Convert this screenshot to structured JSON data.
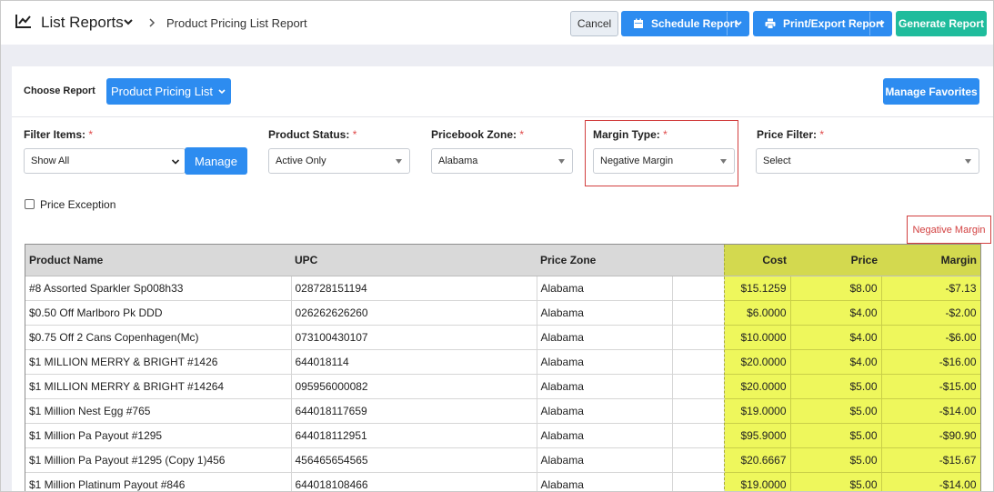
{
  "header": {
    "app_title": "List Reports",
    "breadcrumb": "Product Pricing List Report",
    "cancel_label": "Cancel",
    "schedule_label": "Schedule Report",
    "print_label": "Print/Export Report",
    "generate_label": "Generate Report"
  },
  "report_bar": {
    "choose_label": "Choose Report",
    "report_button_label": "Product Pricing List",
    "manage_favorites_label": "Manage Favorites"
  },
  "filters": {
    "filter_items": {
      "label": "Filter Items:",
      "value": "Show All",
      "manage_label": "Manage"
    },
    "product_status": {
      "label": "Product Status:",
      "value": "Active Only"
    },
    "pricebook_zone": {
      "label": "Pricebook Zone:",
      "value": "Alabama"
    },
    "margin_type": {
      "label": "Margin Type:",
      "value": "Negative Margin"
    },
    "price_filter": {
      "label": "Price Filter:",
      "value": "Select"
    },
    "required_mark": "*",
    "price_exception_label": "Price Exception"
  },
  "annotation": {
    "tag": "Negative Margin"
  },
  "table": {
    "columns": [
      "Product Name",
      "UPC",
      "Price Zone",
      "",
      "Cost",
      "Price",
      "Margin"
    ],
    "rows": [
      [
        "#8 Assorted Sparkler Sp008h33",
        "028728151194",
        "Alabama",
        "",
        "$15.1259",
        "$8.00",
        "-$7.13"
      ],
      [
        "$0.50 Off Marlboro Pk DDD",
        "026262626260",
        "Alabama",
        "",
        "$6.0000",
        "$4.00",
        "-$2.00"
      ],
      [
        "$0.75 Off 2 Cans Copenhagen(Mc)",
        "073100430107",
        "Alabama",
        "",
        "$10.0000",
        "$4.00",
        "-$6.00"
      ],
      [
        "$1 MILLION MERRY & BRIGHT #1426",
        "644018114",
        "Alabama",
        "",
        "$20.0000",
        "$4.00",
        "-$16.00"
      ],
      [
        "$1 MILLION MERRY & BRIGHT #14264",
        "095956000082",
        "Alabama",
        "",
        "$20.0000",
        "$5.00",
        "-$15.00"
      ],
      [
        "$1 Million Nest Egg #765",
        "644018117659",
        "Alabama",
        "",
        "$19.0000",
        "$5.00",
        "-$14.00"
      ],
      [
        "$1 Million Pa Payout #1295",
        "644018112951",
        "Alabama",
        "",
        "$95.9000",
        "$5.00",
        "-$90.90"
      ],
      [
        "$1 Million Pa Payout #1295 (Copy 1)456",
        "456465654565",
        "Alabama",
        "",
        "$20.6667",
        "$5.00",
        "-$15.67"
      ],
      [
        "$1 Million Platinum Payout #846",
        "644018108466",
        "Alabama",
        "",
        "$19.0000",
        "$5.00",
        "-$14.00"
      ]
    ]
  },
  "colors": {
    "primary_blue": "#2d8cf0",
    "teal": "#1fbc9c",
    "highlight_yellow": "#eef75c",
    "annotation_red": "#d23f3f"
  }
}
